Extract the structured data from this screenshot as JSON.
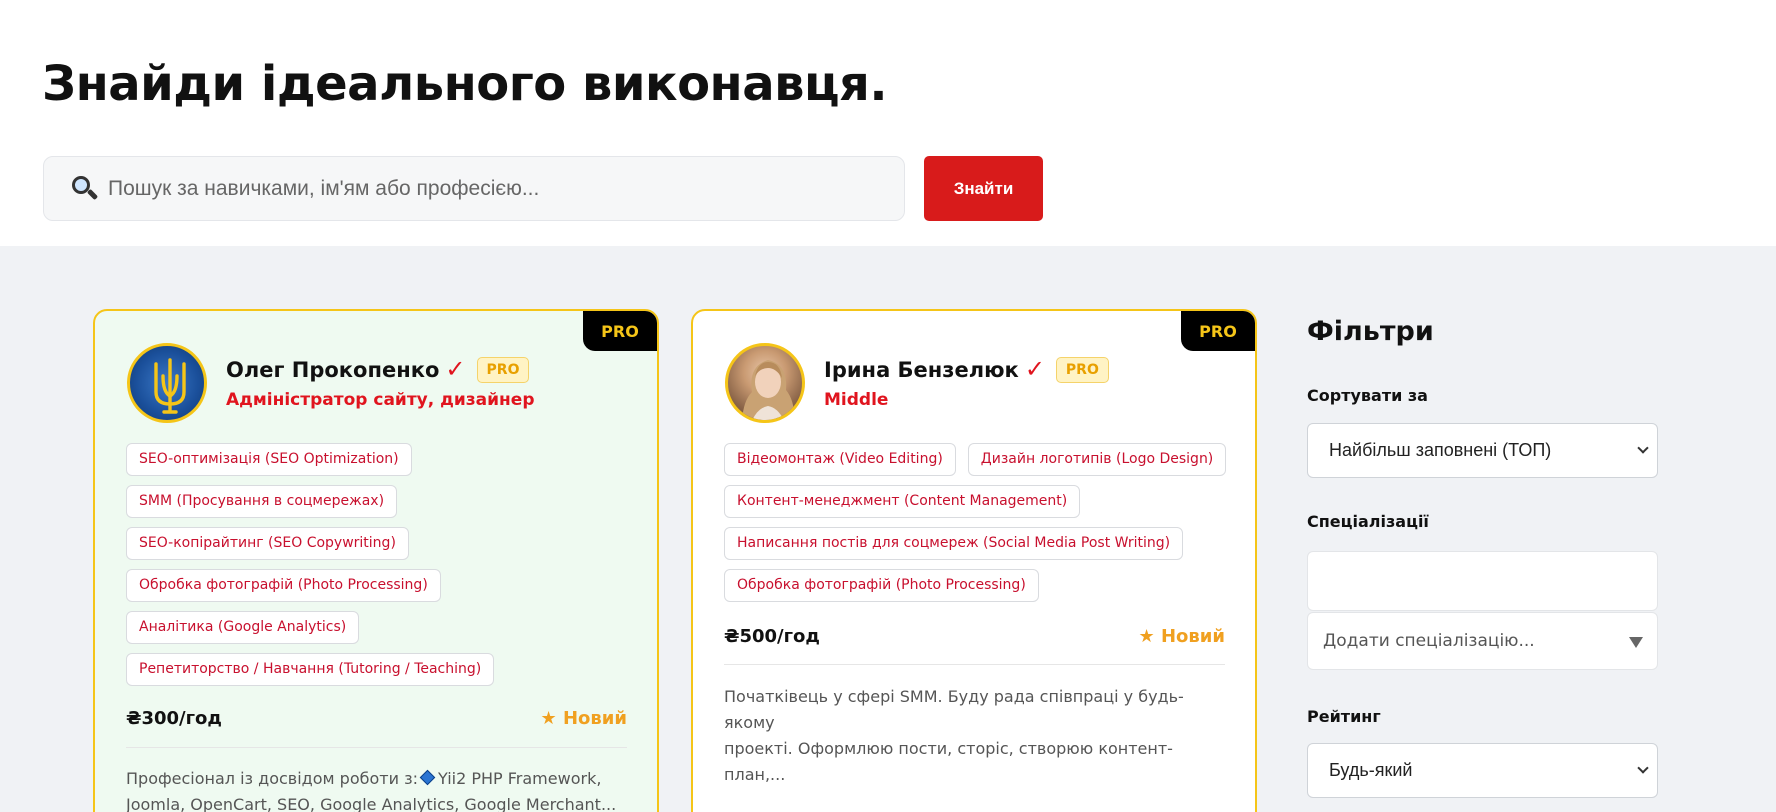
{
  "hero": {
    "title": "Знайди ідеального виконавця.",
    "search_placeholder": "Пошук за навичками, ім'ям або професією...",
    "search_button": "Знайти",
    "search_icon": "magnifier-icon"
  },
  "cards": [
    {
      "corner_badge": "PRO",
      "avatar": "ukraine-coat-of-arms-avatar",
      "name": "Олег Прокопенко",
      "verified_mark": "✓",
      "pro_badge": "PRO",
      "role": "Адміністратор сайту, дизайнер",
      "tags": [
        "SEO-оптимізація (SEO Optimization)",
        "SMM (Просування в соцмережах)",
        "SEO-копірайтинг (SEO Copywriting)",
        "Обробка фотографій (Photo Processing)",
        "Аналітика (Google Analytics)",
        "Репетиторство / Навчання (Tutoring / Teaching)"
      ],
      "rate": "₴300/год",
      "status": "★ Новий",
      "description_line1_a": "Професіонал із досвідом роботи з:",
      "description_line1_b": "Yii2 PHP Framework,",
      "description_line2": "Joomla, OpenCart, SEO, Google Analytics, Google Merchant..."
    },
    {
      "corner_badge": "PRO",
      "avatar": "woman-portrait-avatar",
      "name": "Ірина Бензелюк",
      "verified_mark": "✓",
      "pro_badge": "PRO",
      "role": "Middle",
      "tags": [
        "Відеомонтаж (Video Editing)",
        "Дизайн логотипів (Logo Design)",
        "Контент-менеджмент (Content Management)",
        "Написання постів для соцмереж (Social Media Post Writing)",
        "Обробка фотографій (Photo Processing)"
      ],
      "rate": "₴500/год",
      "status": "★ Новий",
      "description_line1": "Початківець у сфері SMM. Буду рада співпраці у будь-якому",
      "description_line2": "проекті. Оформлюю пости, сторіс, створюю контент-план,..."
    }
  ],
  "filters": {
    "title": "Фільтри",
    "sort_label": "Сортувати за",
    "sort_value": "Найбільш заповнені (ТОП)",
    "spec_label": "Спеціалізації",
    "spec_add_placeholder": "Додати спеціалізацію...",
    "rating_label": "Рейтинг",
    "rating_value": "Будь-який"
  }
}
